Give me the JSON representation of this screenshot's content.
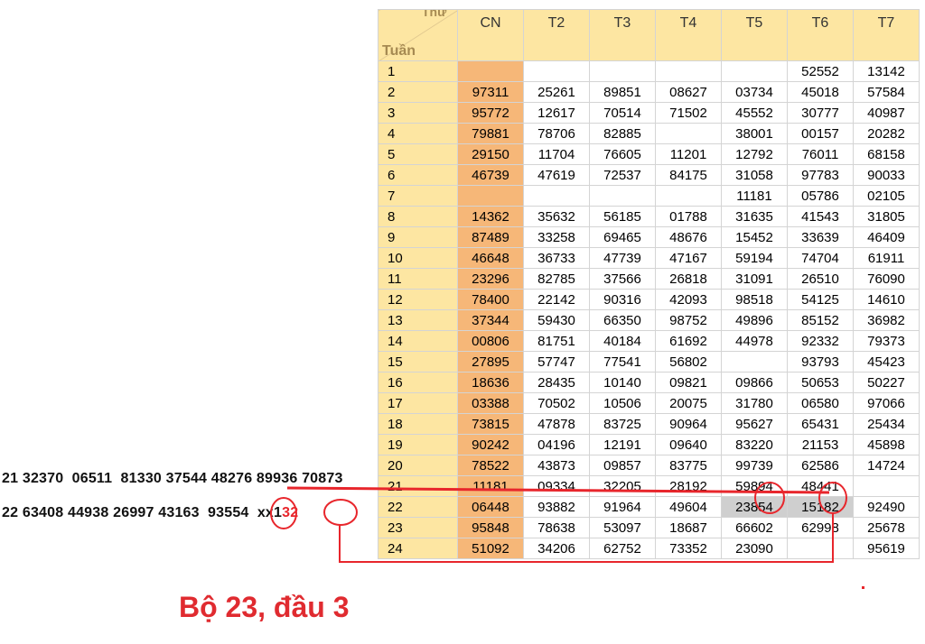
{
  "table": {
    "corner_top": "Thứ",
    "corner_bottom": "Tuần",
    "headers": [
      "CN",
      "T2",
      "T3",
      "T4",
      "T5",
      "T6",
      "T7"
    ],
    "rows": [
      [
        "1",
        "",
        "",
        "",
        "",
        "",
        "52552",
        "13142"
      ],
      [
        "2",
        "97311",
        "25261",
        "89851",
        "08627",
        "03734",
        "45018",
        "57584"
      ],
      [
        "3",
        "95772",
        "12617",
        "70514",
        "71502",
        "45552",
        "30777",
        "40987"
      ],
      [
        "4",
        "79881",
        "78706",
        "82885",
        "",
        "38001",
        "00157",
        "20282"
      ],
      [
        "5",
        "29150",
        "11704",
        "76605",
        "11201",
        "12792",
        "76011",
        "68158"
      ],
      [
        "6",
        "46739",
        "47619",
        "72537",
        "84175",
        "31058",
        "97783",
        "90033"
      ],
      [
        "7",
        "",
        "",
        "",
        "",
        "11181",
        "05786",
        "02105"
      ],
      [
        "8",
        "14362",
        "35632",
        "56185",
        "01788",
        "31635",
        "41543",
        "31805"
      ],
      [
        "9",
        "87489",
        "33258",
        "69465",
        "48676",
        "15452",
        "33639",
        "46409"
      ],
      [
        "10",
        "46648",
        "36733",
        "47739",
        "47167",
        "59194",
        "74704",
        "61911"
      ],
      [
        "11",
        "23296",
        "82785",
        "37566",
        "26818",
        "31091",
        "26510",
        "76090"
      ],
      [
        "12",
        "78400",
        "22142",
        "90316",
        "42093",
        "98518",
        "54125",
        "14610"
      ],
      [
        "13",
        "37344",
        "59430",
        "66350",
        "98752",
        "49896",
        "85152",
        "36982"
      ],
      [
        "14",
        "00806",
        "81751",
        "40184",
        "61692",
        "44978",
        "92332",
        "79373"
      ],
      [
        "15",
        "27895",
        "57747",
        "77541",
        "56802",
        "",
        "93793",
        "45423"
      ],
      [
        "16",
        "18636",
        "28435",
        "10140",
        "09821",
        "09866",
        "50653",
        "50227"
      ],
      [
        "17",
        "03388",
        "70502",
        "10506",
        "20075",
        "31780",
        "06580",
        "97066"
      ],
      [
        "18",
        "73815",
        "47878",
        "83725",
        "90964",
        "95627",
        "65431",
        "25434"
      ],
      [
        "19",
        "90242",
        "04196",
        "12191",
        "09640",
        "83220",
        "21153",
        "45898"
      ],
      [
        "20",
        "78522",
        "43873",
        "09857",
        "83775",
        "99739",
        "62586",
        "14724"
      ],
      [
        "21",
        "11181",
        "09334",
        "32205",
        "28192",
        "59894",
        "48441",
        ""
      ],
      [
        "22",
        "06448",
        "93882",
        "91964",
        "49604",
        "23854",
        "15182",
        "92490"
      ],
      [
        "23",
        "95848",
        "78638",
        "53097",
        "18687",
        "66602",
        "62998",
        "25678"
      ],
      [
        "24",
        "51092",
        "34206",
        "62752",
        "73352",
        "23090",
        "",
        "95619"
      ]
    ]
  },
  "sequence_lines": {
    "line1": "21 32370  06511  81330 37544 48276 89936 70873",
    "line2_main": "22 63408 44938 26997 43163  93554  xx1",
    "line2_red": "32"
  },
  "caption": "Bộ 23, đầu 3",
  "colors": {
    "cn_column": "#f6b778",
    "header_bg": "#fde6a2",
    "highlight": "#cfcfcf",
    "annotation_red": "#e8262c"
  }
}
